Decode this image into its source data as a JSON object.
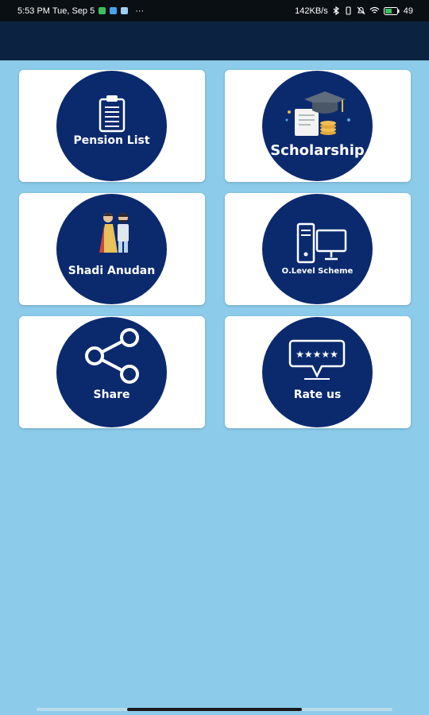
{
  "status_bar": {
    "time": "5:53 PM Tue, Sep 5",
    "more": "···",
    "net_speed": "142KB/s",
    "battery": "49"
  },
  "tiles": [
    {
      "label": "Pension List",
      "icon": "clipboard-icon"
    },
    {
      "label": "Scholarship",
      "icon": "graduation-cap-icon"
    },
    {
      "label": "Shadi Anudan",
      "icon": "wedding-couple-icon"
    },
    {
      "label": "O.Level Scheme",
      "icon": "desktop-computer-icon"
    },
    {
      "label": "Share",
      "icon": "share-icon"
    },
    {
      "label": "Rate us",
      "icon": "rating-stars-icon"
    }
  ],
  "colors": {
    "background": "#8ccbea",
    "app_bar": "#0b2340",
    "circle": "#0b2a6e",
    "card": "#ffffff"
  }
}
